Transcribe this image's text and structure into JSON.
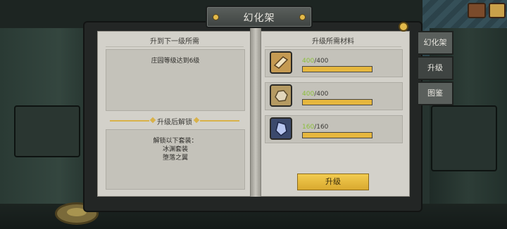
{
  "title": "幻化架",
  "left_page": {
    "requirement_header": "升到下一级所需",
    "requirement_text": "庄园等级达到6级",
    "unlock_header": "升级后解锁",
    "unlock_lines": [
      "解锁以下套装：",
      "冰渊套装",
      "堕落之翼"
    ]
  },
  "right_page": {
    "materials_header": "升级所需材料",
    "materials": [
      {
        "icon": "wood-plank-icon",
        "have": "400",
        "need": "400",
        "sep": "/",
        "progress": 1.0
      },
      {
        "icon": "stone-ore-icon",
        "have": "400",
        "need": "400",
        "sep": "/",
        "progress": 1.0
      },
      {
        "icon": "crystal-icon",
        "have": "160",
        "need": "160",
        "sep": "/",
        "progress": 1.0
      }
    ],
    "upgrade_label": "升级"
  },
  "side_tabs": [
    {
      "label": "幻化架",
      "active": false
    },
    {
      "label": "升级",
      "active": true
    },
    {
      "label": "图鉴",
      "active": false
    }
  ],
  "colors": {
    "accent": "#e6b73e",
    "have_count": "#8bbf3a"
  }
}
